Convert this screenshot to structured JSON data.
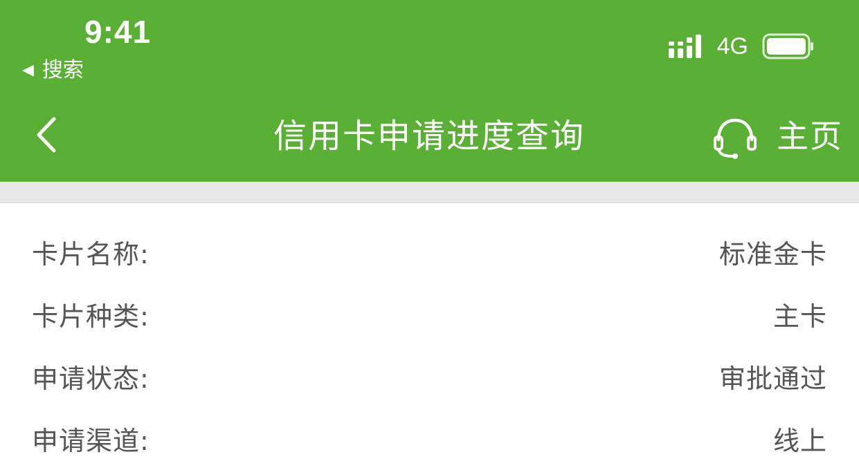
{
  "status_bar": {
    "time": "9:41",
    "back_app_label": "搜索",
    "network": "4G"
  },
  "nav": {
    "title": "信用卡申请进度查询",
    "home_label": "主页"
  },
  "details": [
    {
      "label": "卡片名称:",
      "value": "标准金卡"
    },
    {
      "label": "卡片种类:",
      "value": "主卡"
    },
    {
      "label": "申请状态:",
      "value": "审批通过"
    },
    {
      "label": "申请渠道:",
      "value": "线上"
    }
  ],
  "colors": {
    "header_green": "#5aaf35",
    "separator_grey": "#e8e8e8",
    "text_grey": "#555555"
  },
  "icons": [
    "back-chevron-icon",
    "customer-service-headset-icon",
    "cellular-signal-icon",
    "battery-icon",
    "back-triangle-icon"
  ]
}
